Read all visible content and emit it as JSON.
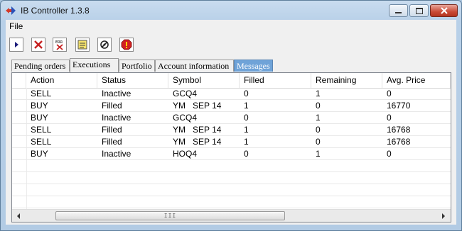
{
  "window": {
    "title": "IB Controller 1.3.8"
  },
  "menu": {
    "file": "File"
  },
  "toolbar": [
    {
      "name": "play-button",
      "icon": "play-icon"
    },
    {
      "name": "cancel-button",
      "icon": "close-icon"
    },
    {
      "name": "error-clear-button",
      "icon": "err-icon"
    },
    {
      "name": "notes-button",
      "icon": "notes-icon"
    },
    {
      "name": "connect-button",
      "icon": "connect-icon"
    },
    {
      "name": "alert-button",
      "icon": "alert-icon"
    }
  ],
  "tabs": [
    {
      "label": "Pending orders",
      "active": false
    },
    {
      "label": "Executions",
      "active": true
    },
    {
      "label": "Portfolio",
      "active": false
    },
    {
      "label": "Account information",
      "active": false
    },
    {
      "label": "Messages",
      "active": false,
      "highlight": true
    }
  ],
  "table": {
    "columns": [
      "Action",
      "Status",
      "Symbol",
      "Filled",
      "Remaining",
      "Avg. Price"
    ],
    "rows": [
      [
        "SELL",
        "Inactive",
        "GCQ4",
        "0",
        "1",
        "0"
      ],
      [
        "BUY",
        "Filled",
        "YM   SEP 14",
        "1",
        "0",
        "16770"
      ],
      [
        "BUY",
        "Inactive",
        "GCQ4",
        "0",
        "1",
        "0"
      ],
      [
        "SELL",
        "Filled",
        "YM   SEP 14",
        "1",
        "0",
        "16768"
      ],
      [
        "SELL",
        "Filled",
        "YM   SEP 14",
        "1",
        "0",
        "16768"
      ],
      [
        "BUY",
        "Inactive",
        "HOQ4",
        "0",
        "1",
        "0"
      ]
    ]
  },
  "scrollbar": {
    "grip": "III"
  },
  "colors": {
    "titlebar": "#b8d0e8",
    "messages_tab": "#6fa3d8",
    "close_button": "#c94a36"
  }
}
